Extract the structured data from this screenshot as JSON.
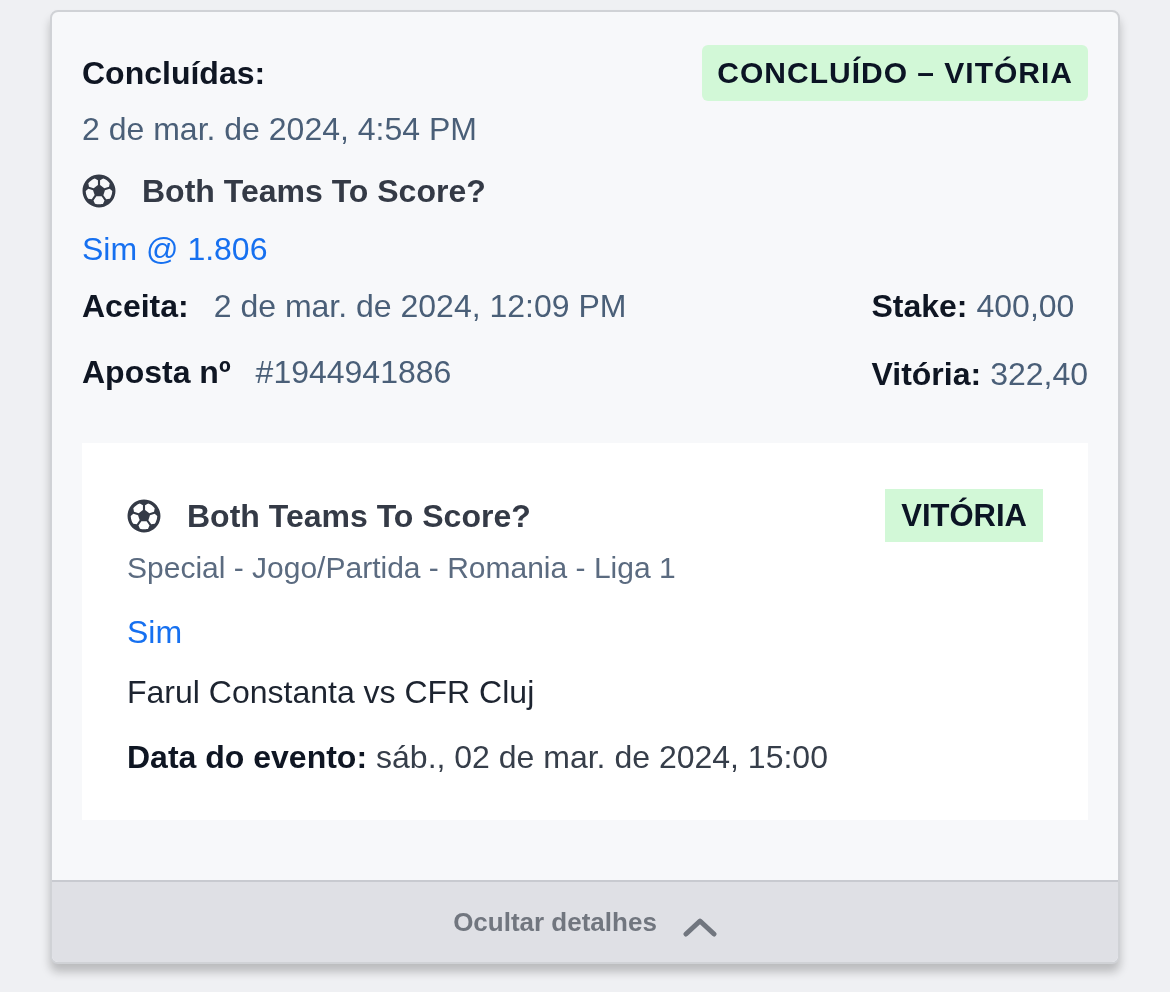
{
  "header": {
    "status_label": "Concluídas:",
    "status_badge": {
      "text": "CONCLUÍDO – VITÓRIA",
      "won": true
    },
    "settled_at": "2 de mar. de 2024, 4:54 PM"
  },
  "summary": {
    "market": "Both Teams To Score?",
    "pick": "Sim @ 1.806",
    "details_left": [
      {
        "label": "Aceita:",
        "value": "2 de mar. de 2024, 12:09 PM"
      },
      {
        "label": "Aposta nº",
        "value": "#1944941886"
      }
    ],
    "details_right": [
      {
        "label": "Stake:",
        "value": "400,00"
      },
      {
        "label": "Vitória:",
        "value": "322,40"
      }
    ]
  },
  "selections": [
    {
      "market": "Both Teams To Score?",
      "result": {
        "text": "VITÓRIA",
        "won": true
      },
      "competition": "Special - Jogo/Partida - Romania - Liga 1",
      "pick": "Sim",
      "event": "Farul Constanta vs CFR Cluj",
      "date_label": "Data do evento:",
      "date": "sáb., 02 de mar. de 2024, 15:00"
    }
  ],
  "toggle": {
    "label": "Ocultar detalhes",
    "expanded": true
  }
}
